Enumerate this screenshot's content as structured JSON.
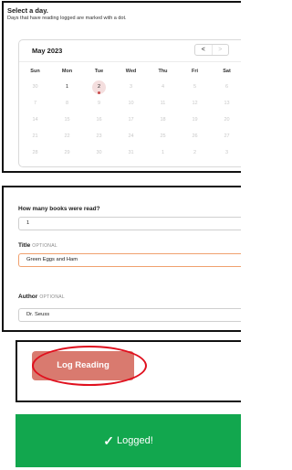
{
  "calendar": {
    "title": "Select a day.",
    "subtitle": "Days that have reading logged are marked with a dot.",
    "month": "May 2023",
    "prev_icon": "<",
    "next_icon": ">",
    "weekdays": [
      "Sun",
      "Mon",
      "Tue",
      "Wed",
      "Thu",
      "Fri",
      "Sat"
    ],
    "weeks": [
      [
        "30",
        "1",
        "2",
        "3",
        "4",
        "5",
        "6"
      ],
      [
        "7",
        "8",
        "9",
        "10",
        "11",
        "12",
        "13"
      ],
      [
        "14",
        "15",
        "16",
        "17",
        "18",
        "19",
        "20"
      ],
      [
        "21",
        "22",
        "23",
        "24",
        "25",
        "26",
        "27"
      ],
      [
        "28",
        "29",
        "30",
        "31",
        "1",
        "2",
        "3"
      ]
    ],
    "selectable_days": [
      "1"
    ],
    "logged_day": "2"
  },
  "form": {
    "books_label": "How many books were read?",
    "books_value": "1",
    "title_label": "Title",
    "title_optional": "OPTIONAL",
    "title_value": "Green Eggs and Ham",
    "author_label": "Author",
    "author_optional": "OPTIONAL",
    "author_value": "Dr. Seuss"
  },
  "action": {
    "log_button": "Log Reading"
  },
  "confirmation": {
    "check_icon": "✓",
    "text": "Logged!"
  },
  "colors": {
    "accent": "#d97a6f",
    "highlight_ring": "#e0101e",
    "success": "#12a74e",
    "focus_border": "#f0a16e",
    "dot": "#c94b4b"
  }
}
